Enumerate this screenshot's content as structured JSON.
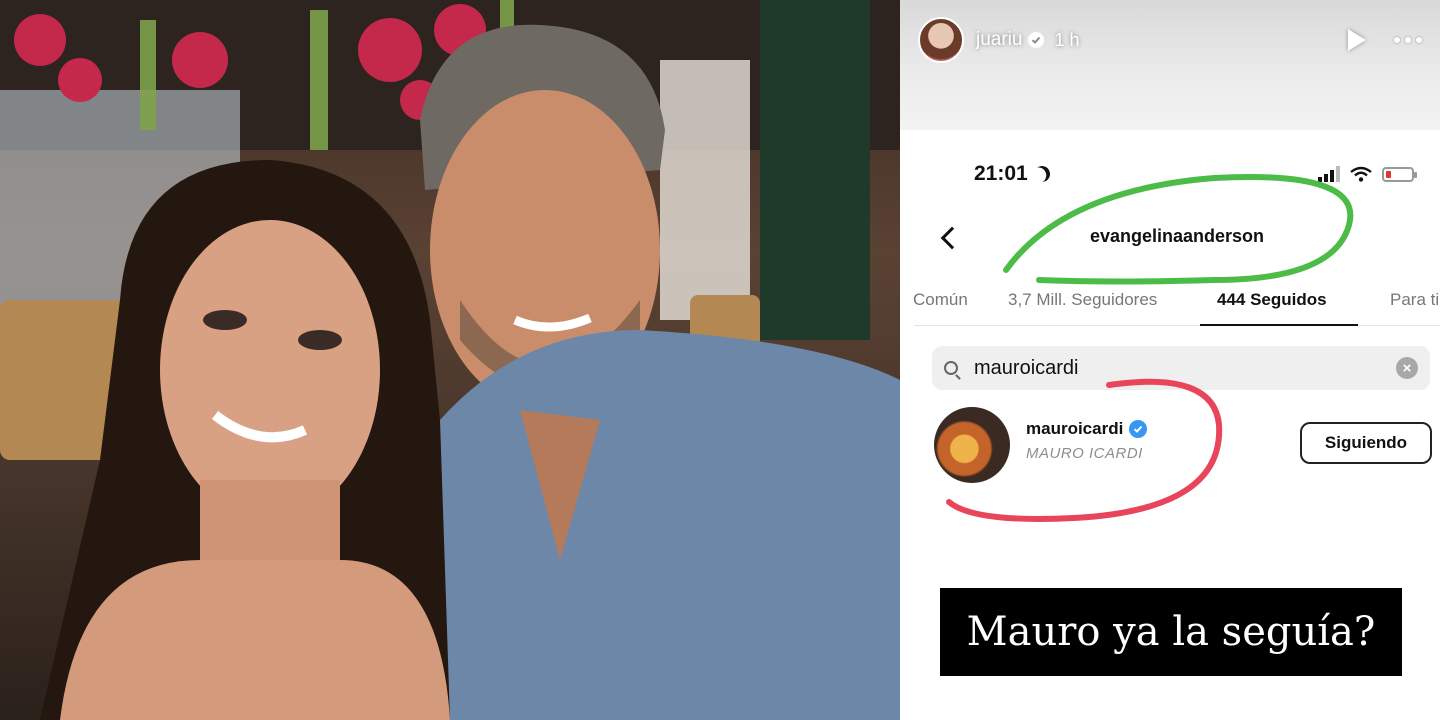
{
  "story": {
    "username": "juariu",
    "time": "1 h"
  },
  "screenshot": {
    "status_time": "21:01",
    "profile_name": "evangelinaanderson",
    "tabs": [
      {
        "label": "Común"
      },
      {
        "label": "3,7 Mill. Seguidores"
      },
      {
        "label": "444 Seguidos",
        "active": true
      },
      {
        "label": "Para ti"
      }
    ],
    "search_value": "mauroicardi",
    "result": {
      "username": "mauroicardi",
      "full_name": "MAURO ICARDI",
      "button_label": "Siguiendo"
    },
    "annotation_colors": {
      "green": "#4cbb47",
      "red": "#e8455a"
    }
  },
  "caption": "Mauro ya la seguía?"
}
